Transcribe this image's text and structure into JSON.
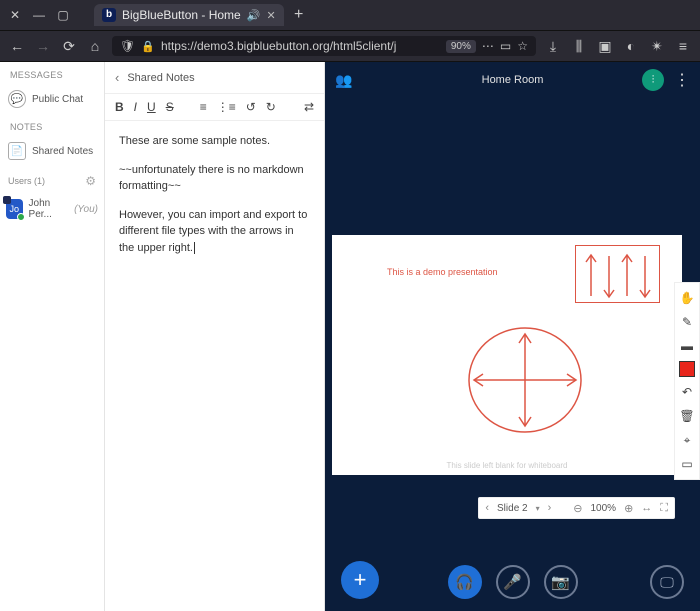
{
  "browser": {
    "tab": {
      "title": "BigBlueButton - Home"
    },
    "url": "https://demo3.bigbluebutton.org/html5client/j",
    "zoom": "90%"
  },
  "sidebar": {
    "sections": {
      "messages": "Messages",
      "notes": "Notes"
    },
    "publicChat": "Public Chat",
    "sharedNotes": "Shared Notes",
    "usersHeader": "Users (1)",
    "user": {
      "initials": "Jo",
      "name": "John Per...",
      "you": "(You)"
    }
  },
  "notesPanel": {
    "title": "Shared Notes",
    "body": {
      "p1": "These are some sample notes.",
      "p2": "~~unfortunately there is no markdown formatting~~",
      "p3": "However, you can import and export to different file types with the arrows in the upper right."
    }
  },
  "room": {
    "title": "Home Room",
    "slide": {
      "demoText": "This is a demo presentation",
      "blank": "This slide left blank for whiteboard",
      "navLabel": "Slide 2",
      "zoom": "100%"
    }
  }
}
